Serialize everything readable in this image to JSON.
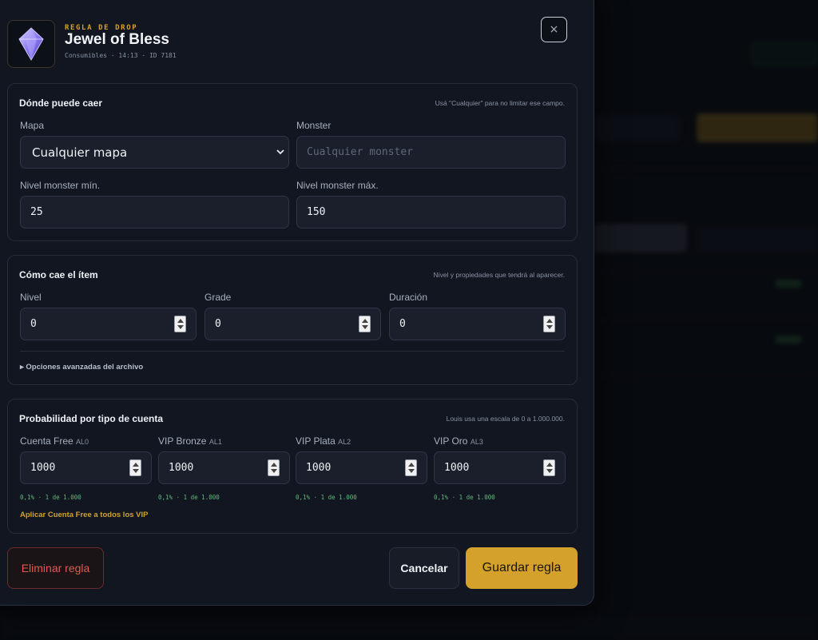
{
  "header": {
    "eyebrow": "REGLA DE DROP",
    "title": "Jewel of Bless",
    "meta": "Consumibles · 14:13 · ID 7181",
    "close_label": "×"
  },
  "location": {
    "title": "Dónde puede caer",
    "hint": "Usá \"Cualquier\" para no limitar ese campo.",
    "map_label": "Mapa",
    "map_value": "Cualquier mapa",
    "monster_label": "Monster",
    "monster_placeholder": "Cualquier monster",
    "min_label": "Nivel monster mín.",
    "min_value": "25",
    "max_label": "Nivel monster máx.",
    "max_value": "150"
  },
  "item": {
    "title": "Cómo cae el ítem",
    "hint": "Nivel y propiedades que tendrá al aparecer.",
    "level_label": "Nivel",
    "level_value": "0",
    "grade_label": "Grade",
    "grade_value": "0",
    "duration_label": "Duración",
    "duration_value": "0",
    "advanced_label": "▸ Opciones avanzadas del archivo"
  },
  "probability": {
    "title": "Probabilidad por tipo de cuenta",
    "hint": "Louis usa una escala de 0 a 1.000.000.",
    "accounts": [
      {
        "name": "Cuenta Free",
        "code": "AL0",
        "value": "1000",
        "odds": "0,1% · 1 de 1.000"
      },
      {
        "name": "VIP Bronze",
        "code": "AL1",
        "value": "1000",
        "odds": "0,1% · 1 de 1.000"
      },
      {
        "name": "VIP Plata",
        "code": "AL2",
        "value": "1000",
        "odds": "0,1% · 1 de 1.000"
      },
      {
        "name": "VIP Oro",
        "code": "AL3",
        "value": "1000",
        "odds": "0,1% · 1 de 1.000"
      }
    ],
    "apply_link": "Aplicar Cuenta Free a todos los VIP"
  },
  "actions": {
    "delete": "Eliminar regla",
    "cancel": "Cancelar",
    "save": "Guardar regla"
  },
  "colors": {
    "accent": "#d4a12b",
    "danger": "#e05a4f",
    "success": "#62b87a",
    "panel": "#111620"
  }
}
